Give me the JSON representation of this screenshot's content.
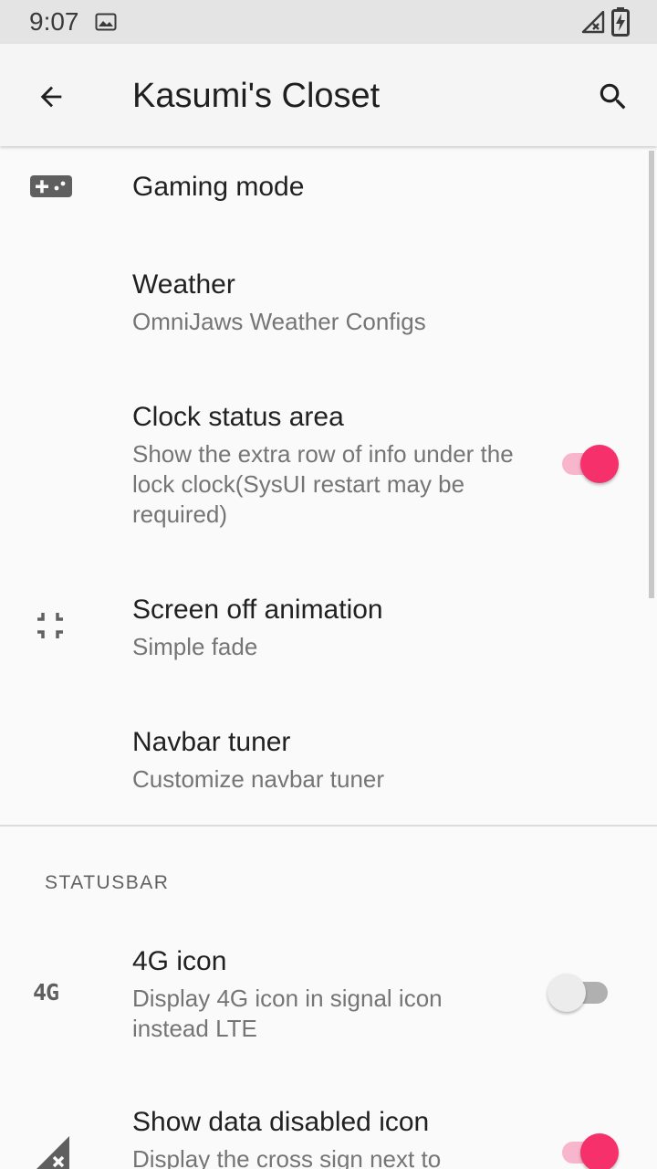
{
  "status_bar": {
    "time": "9:07",
    "icons": [
      "image-icon",
      "signal-off-icon",
      "battery-charging-icon"
    ]
  },
  "app_bar": {
    "title": "Kasumi's Closet",
    "icons": [
      "back-arrow-icon",
      "search-icon"
    ]
  },
  "preferences": [
    {
      "title": "Gaming mode",
      "icon": "gamepad-icon"
    },
    {
      "title": "Weather",
      "summary": "OmniJaws Weather Configs"
    },
    {
      "title": "Clock status area",
      "summary": "Show the extra row of info under the lock clock(SysUI restart may be required)",
      "switch_on": true
    },
    {
      "title": "Screen off animation",
      "summary": "Simple fade",
      "icon": "collapse-icon"
    },
    {
      "title": "Navbar tuner",
      "summary": "Customize navbar tuner"
    }
  ],
  "statusbar_section": {
    "header": "STATUSBAR",
    "items": [
      {
        "title": "4G icon",
        "summary": "Display 4G icon in signal icon instead LTE",
        "icon_text": "4G",
        "switch_on": false
      },
      {
        "title": "Show data disabled icon",
        "summary": "Display the cross sign next to",
        "icon": "signal-cross-icon",
        "switch_on": true
      }
    ]
  },
  "colors": {
    "accent": "#f5306b",
    "accent_track": "#f8b6cd",
    "background": "#fafafa",
    "app_bar": "#f5f5f5",
    "status_bar": "#e4e4e4"
  }
}
